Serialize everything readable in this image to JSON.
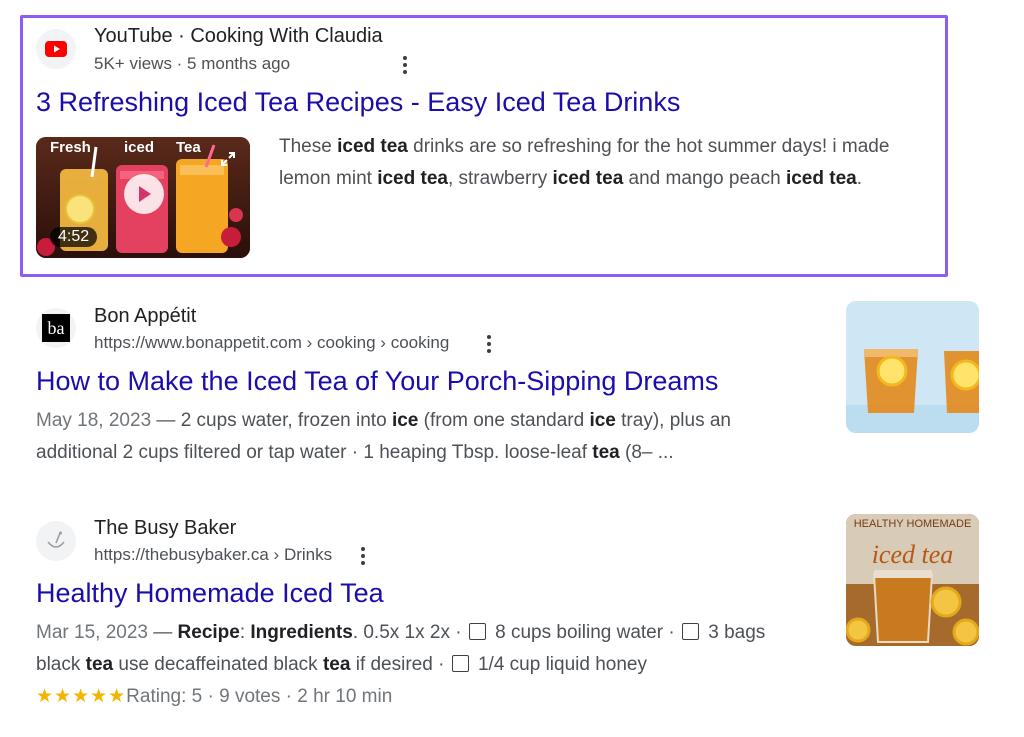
{
  "results": [
    {
      "site_name": "YouTube · Cooking With Claudia",
      "meta": "5K+ views · 5 months ago",
      "title": "3 Refreshing Iced Tea Recipes - Easy Iced Tea Drinks",
      "snippet_line1": [
        {
          "t": "These ",
          "b": false
        },
        {
          "t": "iced tea",
          "b": true
        },
        {
          "t": " drinks are so refreshing for the hot summer days! i made",
          "b": false
        }
      ],
      "snippet_line2": [
        {
          "t": "lemon mint ",
          "b": false
        },
        {
          "t": "iced tea",
          "b": true
        },
        {
          "t": ", strawberry ",
          "b": false
        },
        {
          "t": "iced tea",
          "b": true
        },
        {
          "t": " and mango peach ",
          "b": false
        },
        {
          "t": "iced tea",
          "b": true
        },
        {
          "t": ".",
          "b": false
        }
      ],
      "video": {
        "duration": "4:52",
        "overlay_words": [
          "Fresh",
          "iced",
          "Tea"
        ]
      },
      "favicon_icon": "youtube-play-icon"
    },
    {
      "site_name": "Bon Appétit",
      "url": "https://www.bonappetit.com › cooking › cooking",
      "title": "How to Make the Iced Tea of Your Porch-Sipping Dreams",
      "date": "May 18, 2023",
      "snippet_line1": [
        {
          "t": " — 2 cups water, frozen into ",
          "b": false
        },
        {
          "t": "ice",
          "b": true
        },
        {
          "t": " (from one standard ",
          "b": false
        },
        {
          "t": "ice",
          "b": true
        },
        {
          "t": " tray), plus an",
          "b": false
        }
      ],
      "snippet_line2": [
        {
          "t": "additional 2 cups filtered or tap water · 1 heaping Tbsp. loose-leaf ",
          "b": false
        },
        {
          "t": "tea",
          "b": true
        },
        {
          "t": " (8– ...",
          "b": false
        }
      ],
      "favicon_text": "ba",
      "thumbnail_icon": "iced-tea-glasses-image"
    },
    {
      "site_name": "The Busy Baker",
      "url": "https://thebusybaker.ca › Drinks",
      "title": "Healthy Homemade Iced Tea",
      "date": "Mar 15, 2023",
      "snippet_line1": [
        {
          "t": " — ",
          "b": false
        },
        {
          "t": "Recipe",
          "b": true
        },
        {
          "t": ": ",
          "b": false
        },
        {
          "t": "Ingredients",
          "b": true
        },
        {
          "t": ". 0.5x 1x 2x · ",
          "b": false
        },
        {
          "t": "[]",
          "b": false
        },
        {
          "t": " 8 cups boiling water · ",
          "b": false
        },
        {
          "t": "[]",
          "b": false
        },
        {
          "t": " 3 bags",
          "b": false
        }
      ],
      "snippet_line2": [
        {
          "t": "black ",
          "b": false
        },
        {
          "t": "tea",
          "b": true
        },
        {
          "t": " use decaffeinated black ",
          "b": false
        },
        {
          "t": "tea",
          "b": true
        },
        {
          "t": " if desired · ",
          "b": false
        },
        {
          "t": "[]",
          "b": false
        },
        {
          "t": " 1/4 cup liquid honey",
          "b": false
        }
      ],
      "rating": {
        "stars": "★★★★★",
        "text": "Rating: 5 · 9 votes · 2 hr 10 min",
        "value": 5
      },
      "thumbnail_text_line1": "HEALTHY HOMEMADE",
      "thumbnail_text_line2": "iced tea",
      "favicon_icon": "whisk-bowl-icon"
    }
  ],
  "colors": {
    "highlight_border": "#8b5cf6",
    "link": "#1a0dab",
    "star": "#f4b400",
    "youtube_red": "#ff0000"
  }
}
